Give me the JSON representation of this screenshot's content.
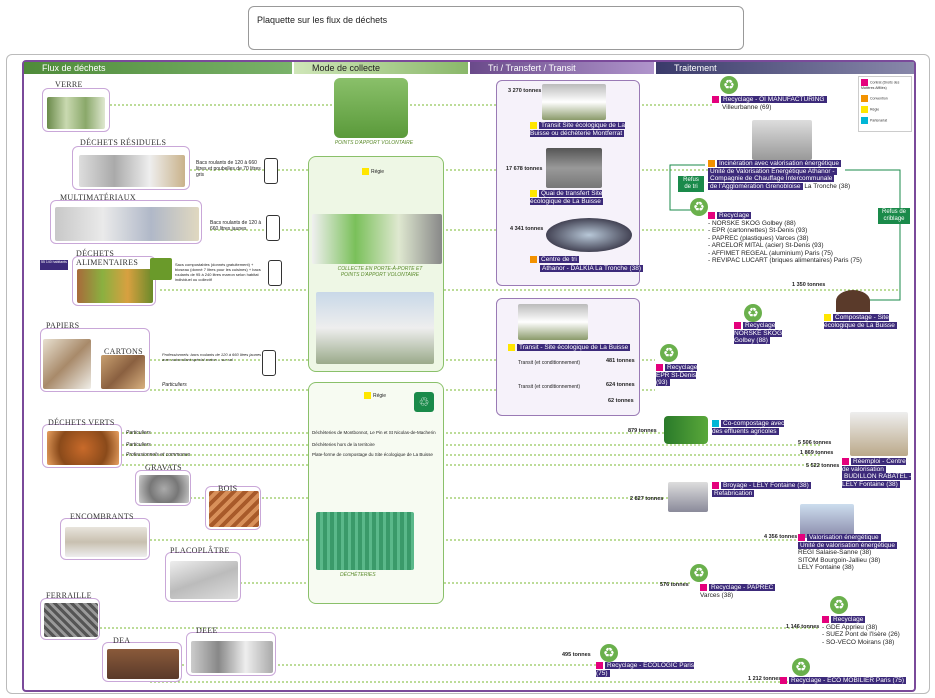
{
  "title": "Plaquette sur les flux de déchets",
  "sections": {
    "flux": "Flux de déchets",
    "mode": "Mode de collecte",
    "tri": "Tri / Transfert / Transit",
    "traitement": "Traitement"
  },
  "categories": {
    "verre": "VERRE",
    "residuels": "DÉCHETS RÉSIDUELS",
    "multimateriaux": "MULTIMATÉRIAUX",
    "alim1": "DÉCHETS",
    "alim2": "ALIMENTAIRES",
    "papiers": "PAPIERS",
    "cartons": "CARTONS",
    "verts": "DÉCHETS VERTS",
    "gravats": "GRAVATS",
    "bois": "BOIS",
    "encombrants": "ENCOMBRANTS",
    "placoplatre": "PLACOPLÂTRE",
    "ferraille": "FERRAILLE",
    "dea": "DEA",
    "deee": "DEEE"
  },
  "notes": {
    "residuels": "Bacs roulants de 120 à 660 litres et poubelles de 70 litres gris",
    "multi": "Bacs roulants de 120 à 660 litres jaunes",
    "alim": "Sacs compostables (donnés gratuitement) + bioseau (donné 7 litres pour les cuisines) + bacs roulants de 95 à 240 litres marron selon habitat individuel ou collectif",
    "alim_count": "55 140 habitants",
    "pros": "Professionnels: bacs roulants de 120 à 660 litres jaunes avec autocollant spécial carton – sur sol",
    "particuliers": "Particuliers",
    "particuliers2": "Particuliers",
    "particuliers3": "Particuliers",
    "pros2": "Professionnels et communes"
  },
  "mode": {
    "pav": "POINTS D'APPORT VOLONTAIRE",
    "regie": "Régie",
    "regie2": "Régie",
    "collecte": "COLLECTE EN PORTE-À-PORTE ET POINTS D'APPORT VOLONTAIRE",
    "dech1": "Déchèteries de Montbonnot, Le Pin et St Nicolas-de-Macherin",
    "dech2": "Déchèteries hors de la territoire",
    "dech3": "Plate-forme de compostage du Site écologique de La Buisse",
    "decheteries": "DÉCHÈTERIES"
  },
  "tri": {
    "t1": "3 270 tonnes",
    "s1": "Transit Site écologique de La Buisse ou déchèterie Montferrat",
    "t2": "17 678 tonnes",
    "s2": "Quai de transfert Site écologique de La Buisse",
    "t3": "4 341 tonnes",
    "s3a": "Centre de tri",
    "s3b": "Athanor - DALKIA La Tronche (38)",
    "s4": "Transit - Site écologique de La Buisse",
    "t4": "481 tonnes",
    "t5": "624 tonnes",
    "t6": "62 tonnes",
    "n4": "Transit (et conditionnement)",
    "n5": "Transit (et conditionnement)"
  },
  "traitement": {
    "r1a": "Recyclage - OI MANUFACTURING",
    "r1b": "Villeurbanne (69)",
    "inc1": "Incinération avec valorisation énergétique",
    "inc2": "Unité de Valorisation Énergétique Athanor -",
    "inc3": "Compagnie de Chauffage Intercommunale",
    "inc4": "de l'Agglomération Grenobloise",
    "inc5": "La Tronche (38)",
    "refus_tri": "Refus de tri",
    "refus_crib": "Refus de criblage",
    "rec_head": "Recyclage",
    "rec_list": [
      "- NORSKE SKOG Golbey (88)",
      "- EPR (cartonnettes) St-Denis (93)",
      "- PAPREC (plastiques) Varces (38)",
      "- ARCELOR MITAL (acier) St-Denis (93)",
      "- AFFIMET REGEAL (aluminium) Paris (75)",
      "- REVIPAC LUCART (briques alimentaires) Paris (75)"
    ],
    "t1350": "1 350 tonnes",
    "comp": "Compostage - Site écologique de La Buisse",
    "rec_norske": "Recyclage NORSKE SKOG Golbey (88)",
    "rec_epr": "Recyclage EPR St-Denis (93)",
    "t879": "879 tonnes",
    "cocomp": "Co-compostage avec des effluents agricoles",
    "t5506": "5 506 tonnes",
    "t1869": "1 869 tonnes",
    "t5522": "5 522 tonnes",
    "remploi1": "Réemploi - Centre de valorisation",
    "remploi2": "BUDILLON RABATEL - LELY Fontaine (38)",
    "t2827": "2 827 tonnes",
    "broy1": "Broyage - LELY Fontaine (38)",
    "broy2": "Refabrication",
    "t4356": "4 356 tonnes",
    "val1": "Valorisation énergétique",
    "val2": "Unité de valorisation énergétique",
    "val3": "REGI Salaise-Sanne (38)",
    "val4": "SITOM Bourgoin-Jallieu (38)",
    "val5": "LELY Fontaine (38)",
    "t576": "576 tonnes",
    "paprec": "Recyclage - PAPREC",
    "paprec2": "Varces (38)",
    "t1146": "1 146 tonnes",
    "rec_fer": [
      "- GDE Apprieu (38)",
      "- SUEZ Pont de l'Isère (26)",
      "- SO-VECO Moirans (38)"
    ],
    "t495": "495 tonnes",
    "ecologic": "Recyclage - ECOLOGIC Paris (75)",
    "t1212": "1 212 tonnes",
    "ecomob": "Recyclage - ECO MOBILIER Paris (75)"
  },
  "legend": [
    "Contrat (Droits des Matières Affiliés)",
    "Convention",
    "Régie",
    "Partenariat"
  ]
}
